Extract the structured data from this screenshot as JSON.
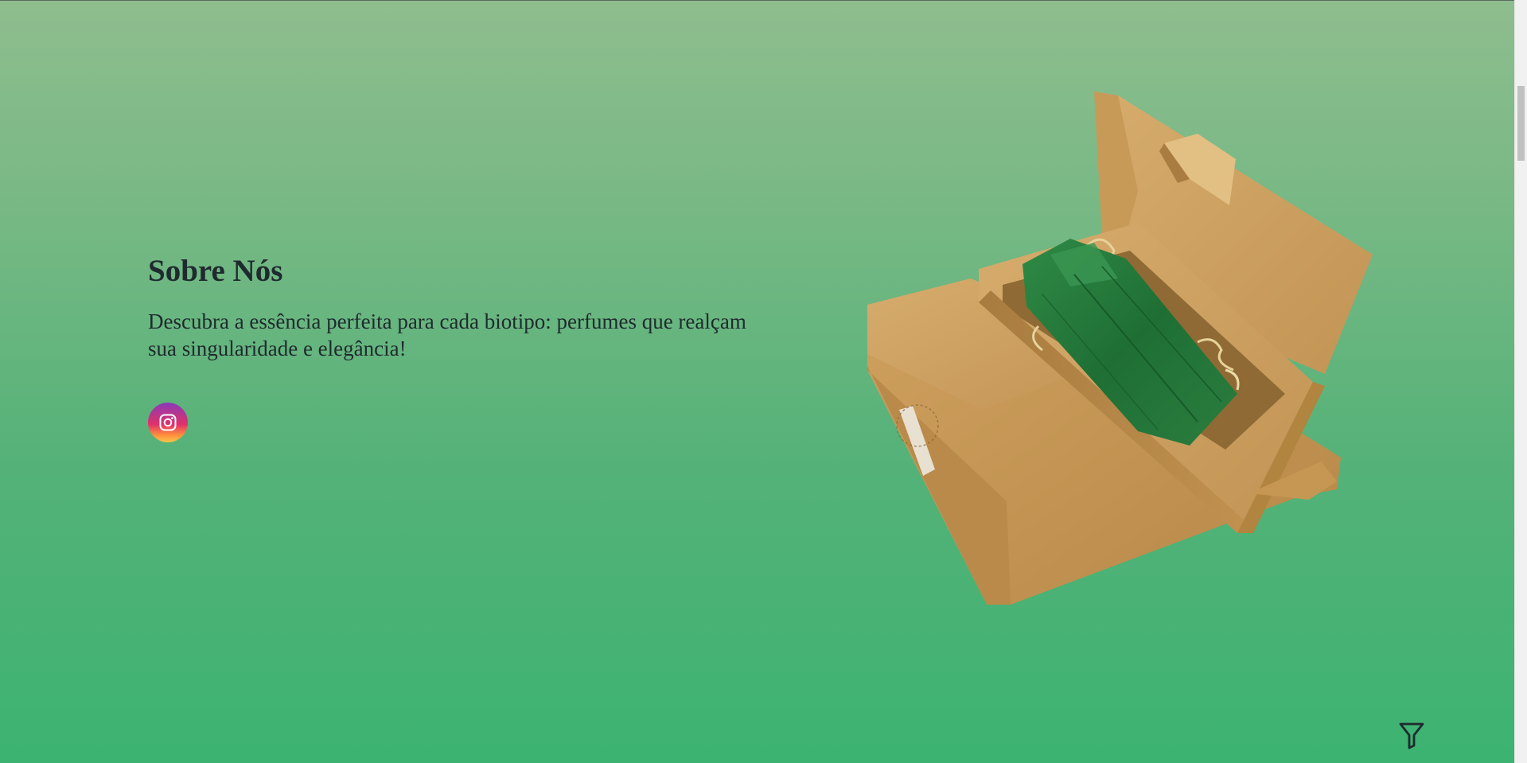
{
  "about": {
    "title": "Sobre Nós",
    "description": "Descubra a essência perfeita para cada biotipo: perfumes que realçam sua singularidade e elegância!"
  },
  "social": {
    "instagram_icon": "instagram-icon"
  },
  "product_image": {
    "subject": "kraft-paper-box-with-green-wrapped-perfume"
  },
  "floating_button": {
    "icon": "funnel-filter-icon"
  },
  "colors": {
    "background_top": "#8fbd8e",
    "background_bottom": "#3cb371",
    "text": "#1f2a2e",
    "instagram_gradient": [
      "#8a3ab9",
      "#e1306c",
      "#fcc646"
    ]
  }
}
